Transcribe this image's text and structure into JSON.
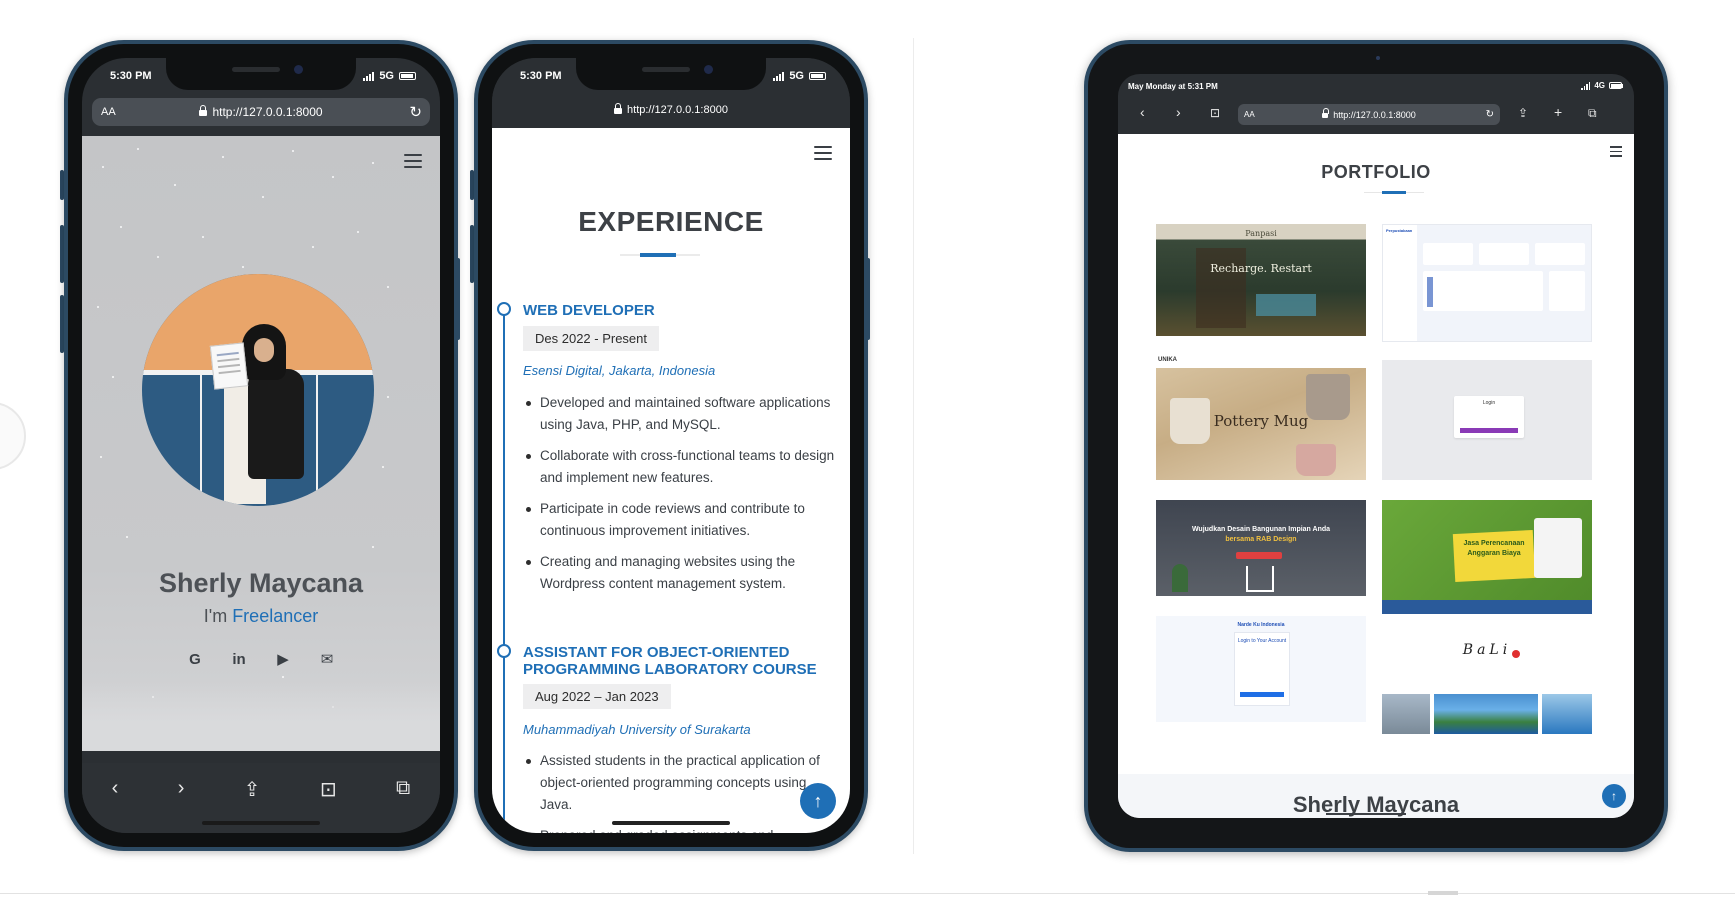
{
  "phone1": {
    "status_time": "5:30 PM",
    "network": "5G",
    "url_aa": "AA",
    "url": "http://127.0.0.1:8000",
    "name": "Sherly Maycana",
    "subtitle_prefix": "I'm ",
    "subtitle_accent": "Freelancer",
    "socials": [
      {
        "icon": "github-icon",
        "glyph": "G"
      },
      {
        "icon": "linkedin-icon",
        "glyph": "in"
      },
      {
        "icon": "youtube-icon",
        "glyph": "▶"
      },
      {
        "icon": "mail-icon",
        "glyph": "✉"
      }
    ],
    "toolbar_glyphs": {
      "back": "‹",
      "forward": "›",
      "share": "⇪",
      "bookmarks": "⊡",
      "tabs": "⧉"
    }
  },
  "phone2": {
    "status_time": "5:30 PM",
    "network": "5G",
    "url": "http://127.0.0.1:8000",
    "section_title": "EXPERIENCE",
    "items": [
      {
        "title": "WEB DEVELOPER",
        "date": "Des 2022 - Present",
        "org": "Esensi Digital, Jakarta, Indonesia",
        "bullets": [
          "Developed and maintained software applications using Java, PHP, and MySQL.",
          "Collaborate with cross-functional teams to design and implement new features.",
          "Participate in code reviews and contribute to continuous improvement initiatives.",
          "Creating and managing websites using the Wordpress content management system."
        ]
      },
      {
        "title": "ASSISTANT FOR OBJECT-ORIENTED PROGRAMMING LABORATORY COURSE",
        "date": "Aug 2022 – Jan 2023",
        "org": "Muhammadiyah University of Surakarta",
        "bullets": [
          "Assisted students in the practical application of object-oriented programming concepts using Java.",
          "Prepared and graded assignments and"
        ]
      }
    ],
    "back_to_top_glyph": "↑"
  },
  "tablet": {
    "status_time": "May Monday at 5:31 PM",
    "network": "4G",
    "url_aa": "AA",
    "url": "http://127.0.0.1:8000",
    "section_title": "PORTFOLIO",
    "thumbs": {
      "t1_brand": "Panpasi",
      "t1_headline": "Recharge. Restart",
      "t2_header": "Perpustakaan",
      "t3_brand": "UNIKA",
      "t3_headline": "Pottery Mug",
      "t4_login": "Login",
      "t5_headline_line1": "Wujudkan Desain Bangunan Impian Anda",
      "t5_headline_line2": "bersama RAB Design",
      "t6_headline_line1": "Jasa Perencanaan",
      "t6_headline_line2": "Anggaran Biaya",
      "t7_title": "Login to Your Account",
      "t7_brand": "Narde Ku Indonesia",
      "t8_brand": "BaLi"
    },
    "footer_name": "Sherly Maycana",
    "back_to_top_glyph": "↑"
  },
  "colors": {
    "accent": "#1f6fb6",
    "frame": "#2c4a63",
    "text_dark": "#3d4146"
  }
}
